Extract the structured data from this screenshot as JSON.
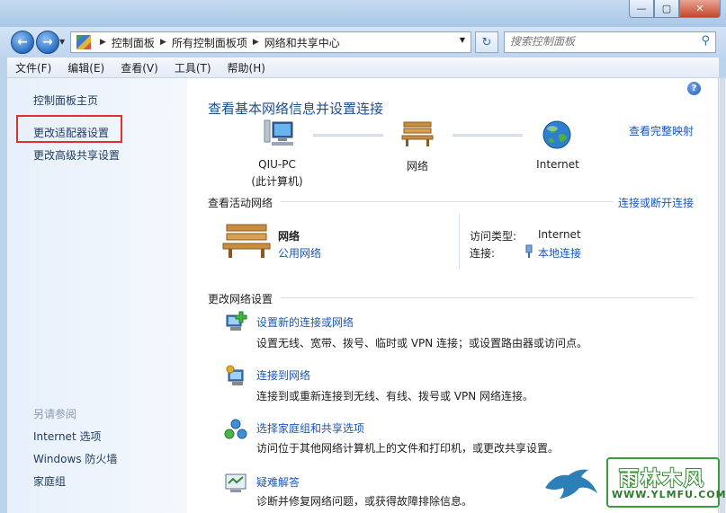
{
  "window": {
    "buttons": [
      "—",
      "▢",
      "✕"
    ]
  },
  "address": {
    "crumbs": [
      "控制面板",
      "所有控制面板项",
      "网络和共享中心"
    ],
    "search_placeholder": "搜索控制面板"
  },
  "menu": [
    "文件(F)",
    "编辑(E)",
    "查看(V)",
    "工具(T)",
    "帮助(H)"
  ],
  "sidebar": {
    "home": "控制面板主页",
    "adapter": "更改适配器设置",
    "advanced": "更改高级共享设置",
    "see_also_title": "另请参阅",
    "see_also": [
      "Internet 选项",
      "Windows 防火墙",
      "家庭组"
    ]
  },
  "main": {
    "title": "查看基本网络信息并设置连接",
    "full_map": "查看完整映射",
    "map_nodes": {
      "pc_name": "QIU-PC",
      "pc_sub": "(此计算机)",
      "network": "网络",
      "internet": "Internet"
    },
    "active_title": "查看活动网络",
    "connect_link": "连接或断开连接",
    "network_name": "网络",
    "network_type": "公用网络",
    "access_label": "访问类型:",
    "access_value": "Internet",
    "connection_label": "连接:",
    "connection_value": "本地连接",
    "change_title": "更改网络设置",
    "tasks": [
      {
        "title": "设置新的连接或网络",
        "desc": "设置无线、宽带、拨号、临时或 VPN 连接；或设置路由器或访问点。"
      },
      {
        "title": "连接到网络",
        "desc": "连接到或重新连接到无线、有线、拨号或 VPN 网络连接。"
      },
      {
        "title": "选择家庭组和共享选项",
        "desc": "访问位于其他网络计算机上的文件和打印机，或更改共享设置。"
      },
      {
        "title": "疑难解答",
        "desc": "诊断并修复网络问题，或获得故障排除信息。"
      }
    ]
  },
  "watermark": {
    "brand": "雨林木风",
    "url": "WWW.YLMFU.COM"
  }
}
